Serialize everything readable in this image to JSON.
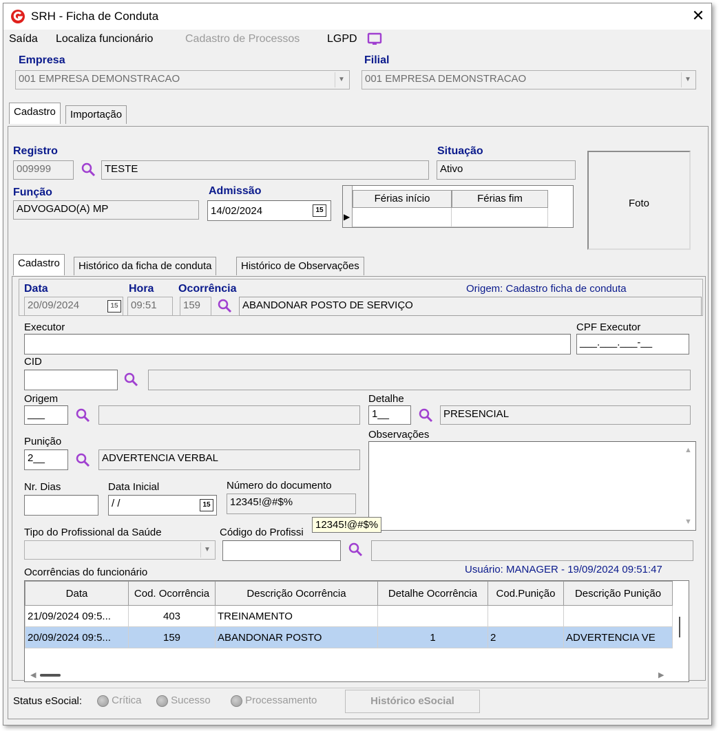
{
  "window": {
    "title": "SRH - Ficha de Conduta",
    "close": "✕"
  },
  "menu": {
    "saida": "Saída",
    "localiza": "Localiza funcionário",
    "cadastro_processos": "Cadastro de Processos",
    "lgpd": "LGPD"
  },
  "empresa": {
    "label": "Empresa",
    "value": "001 EMPRESA DEMONSTRACAO"
  },
  "filial": {
    "label": "Filial",
    "value": "001 EMPRESA DEMONSTRACAO"
  },
  "top_tabs": [
    "Cadastro",
    "Importação"
  ],
  "registro": {
    "label": "Registro",
    "code": "009999",
    "name": "TESTE"
  },
  "situacao": {
    "label": "Situação",
    "value": "Ativo"
  },
  "funcao": {
    "label": "Função",
    "value": "ADVOGADO(A) MP"
  },
  "admissao": {
    "label": "Admissão",
    "value": "14/02/2024"
  },
  "ferias": {
    "col1": "Férias início",
    "col2": "Férias fim"
  },
  "foto": "Foto",
  "inner_tabs": [
    "Cadastro",
    "Histórico da ficha de conduta",
    "Histórico de Observações"
  ],
  "form": {
    "data_label": "Data",
    "data_value": "20/09/2024",
    "hora_label": "Hora",
    "hora_value": "09:51",
    "ocorrencia_label": "Ocorrência",
    "ocorrencia_code": "159",
    "ocorrencia_desc": "ABANDONAR POSTO DE SERVIÇO",
    "origem_note": "Origem: Cadastro ficha de conduta",
    "executor_label": "Executor",
    "executor_value": "",
    "cpf_label": "CPF Executor",
    "cpf_value": "___.___.___-__",
    "cid_label": "CID",
    "origem_label": "Origem",
    "origem_code": "___",
    "detalhe_label": "Detalhe",
    "detalhe_code": "1__",
    "detalhe_desc": "PRESENCIAL",
    "punicao_label": "Punição",
    "punicao_code": "2__",
    "punicao_desc": "ADVERTENCIA VERBAL",
    "observacoes_label": "Observações",
    "nr_dias_label": "Nr. Dias",
    "data_inicial_label": "Data Inicial",
    "data_inicial_value": " /  /",
    "numero_doc_label": "Número do documento",
    "numero_doc_value": "12345!@#$%",
    "tipo_prof_label": "Tipo do Profissional da Saúde",
    "codigo_prof_label": "Código do Profissi",
    "tooltip": "12345!@#$%",
    "usuario": "Usuário: MANAGER - 19/09/2024 09:51:47",
    "ocorrencias_label": "Ocorrências do funcionário"
  },
  "table": {
    "headers": [
      "Data",
      "Cod. Ocorrência",
      "Descrição Ocorrência",
      "Detalhe Ocorrência",
      "Cod.Punição",
      "Descrição Punição"
    ],
    "rows": [
      [
        "21/09/2024 09:5...",
        "403",
        "TREINAMENTO",
        "",
        "",
        ""
      ],
      [
        "20/09/2024 09:5...",
        "159",
        "ABANDONAR POSTO",
        "1",
        "2",
        "ADVERTENCIA VE"
      ]
    ]
  },
  "status": {
    "label": "Status eSocial:",
    "critica": "Crítica",
    "sucesso": "Sucesso",
    "processamento": "Processamento",
    "historico": "Histórico eSocial"
  },
  "icons": {
    "logo": "srh-logo-icon",
    "lgpd": "monitor-icon",
    "search": "search-icon",
    "calendar": "calendar-icon"
  },
  "colors": {
    "label_blue": "#0a1a8c",
    "search_purple": "#a040d0",
    "selected_row": "#b9d3f2",
    "logo_red": "#e0201c"
  }
}
